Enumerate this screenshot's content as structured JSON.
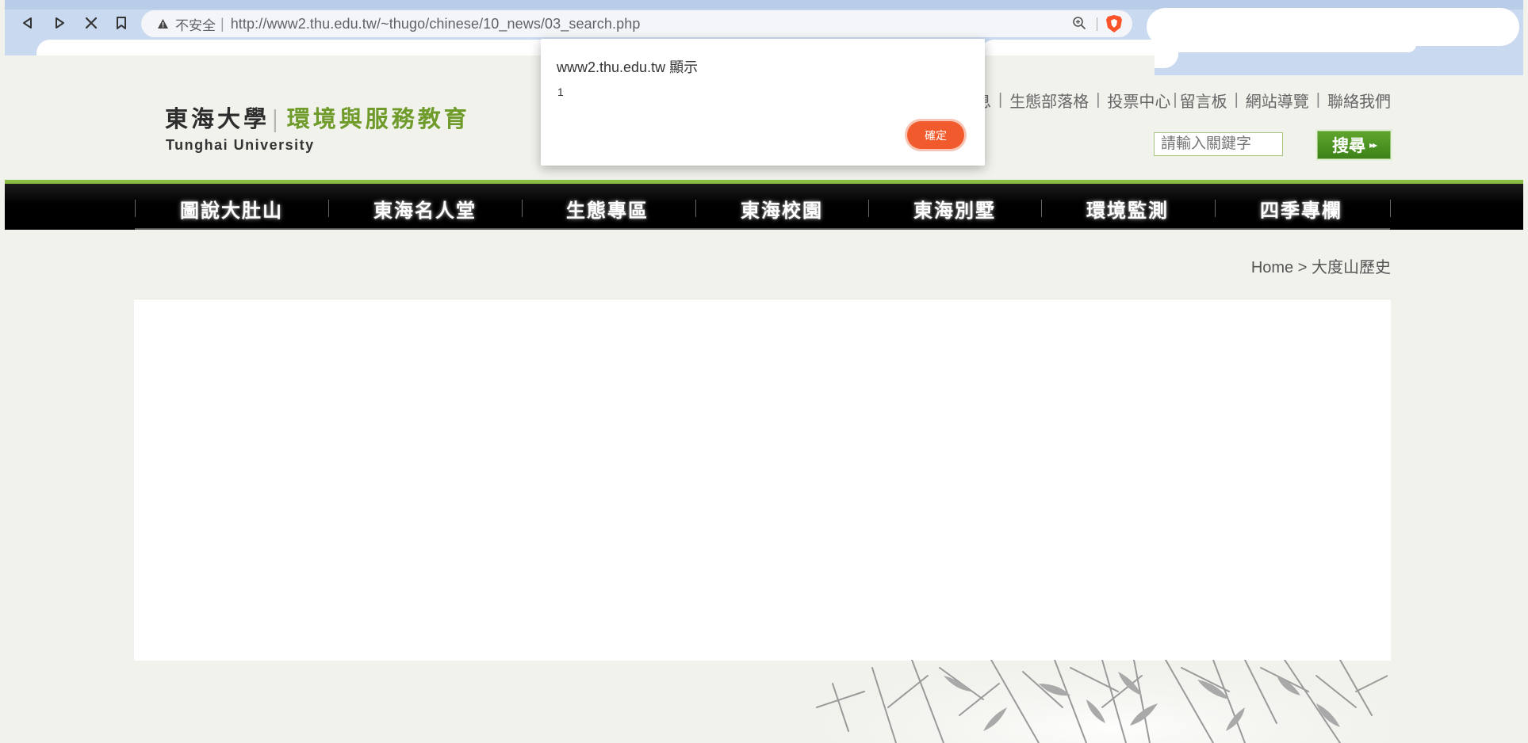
{
  "browser": {
    "insecure_label": "不安全",
    "separator": "|",
    "url": "http://www2.thu.edu.tw/~thugo/chinese/10_news/03_search.php"
  },
  "header": {
    "logo_cn_main": "東海大學",
    "logo_cn_bar": "|",
    "logo_cn_sub": "環境與服務教育",
    "logo_en": "Tunghai University",
    "top_links": [
      "息",
      "生態部落格",
      "投票中心",
      "留言板",
      "網站導覽",
      "聯絡我們"
    ],
    "search": {
      "placeholder": "請輸入關鍵字",
      "button": "搜尋"
    }
  },
  "nav": {
    "items": [
      "圖說大肚山",
      "東海名人堂",
      "生態專區",
      "東海校園",
      "東海別墅",
      "環境監測",
      "四季專欄"
    ]
  },
  "breadcrumb": {
    "home": "Home",
    "arrow": ">",
    "current": "大度山歷史"
  },
  "dialog": {
    "title": "www2.thu.edu.tw 顯示",
    "message": "1",
    "ok_label": "確定",
    "ok_color": "#f05a2c"
  },
  "colors": {
    "brand_green": "#6e9b2a",
    "nav_bg": "#000000",
    "page_bg": "#f1f2ec",
    "accent_line": "#8bbd43"
  }
}
